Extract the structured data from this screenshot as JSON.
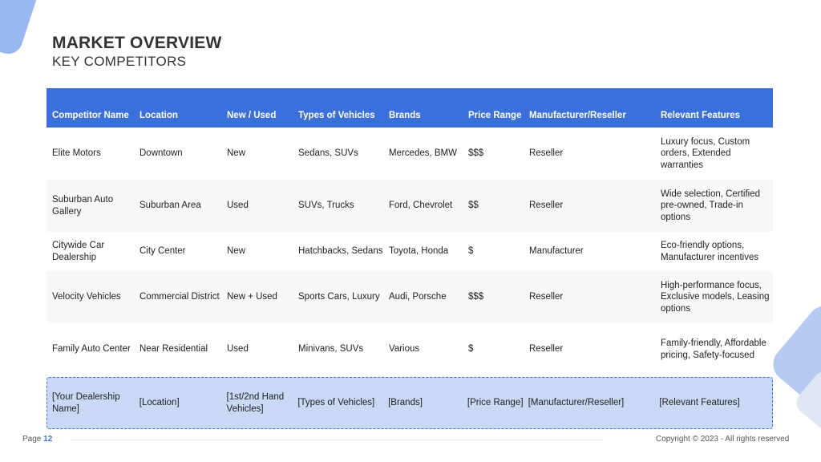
{
  "slide": {
    "title": "MARKET OVERVIEW",
    "subtitle": "KEY COMPETITORS"
  },
  "table": {
    "headers": [
      "Competitor Name",
      "Location",
      "New / Used",
      "Types of Vehicles",
      "Brands",
      "Price Range",
      "Manufacturer/Reseller",
      "Relevant Features"
    ],
    "rows": [
      [
        "Elite Motors",
        "Downtown",
        "New",
        "Sedans, SUVs",
        "Mercedes, BMW",
        "$$$",
        "Reseller",
        "Luxury focus, Custom orders, Extended warranties"
      ],
      [
        "Suburban Auto Gallery",
        "Suburban Area",
        "Used",
        "SUVs, Trucks",
        "Ford, Chevrolet",
        "$$",
        "Reseller",
        "Wide selection, Certified pre-owned, Trade-in options"
      ],
      [
        "Citywide Car Dealership",
        "City Center",
        "New",
        "Hatchbacks, Sedans",
        "Toyota, Honda",
        "$",
        "Manufacturer",
        "Eco-friendly options, Manufacturer incentives"
      ],
      [
        "Velocity Vehicles",
        "Commercial District",
        "New + Used",
        "Sports Cars, Luxury",
        "Audi, Porsche",
        "$$$",
        "Reseller",
        "High-performance focus, Exclusive models, Leasing options"
      ],
      [
        "Family Auto Center",
        "Near Residential",
        "Used",
        "Minivans, SUVs",
        "Various",
        "$",
        "Reseller",
        "Family-friendly, Affordable pricing, Safety-focused"
      ]
    ],
    "placeholder_row": [
      "[Your Dealership Name]",
      "[Location]",
      "[1st/2nd Hand Vehicles]",
      "[Types of Vehicles]",
      "[Brands]",
      "[Price Range]",
      "[Manufacturer/Reseller]",
      "[Relevant Features]"
    ]
  },
  "footer": {
    "page_label": "Page",
    "page_number": "12",
    "copyright": "Copyright © 2023 - All rights reserved"
  },
  "colors": {
    "accent": "#3b6fdb",
    "placeholder_fill": "#c8d8f5"
  }
}
